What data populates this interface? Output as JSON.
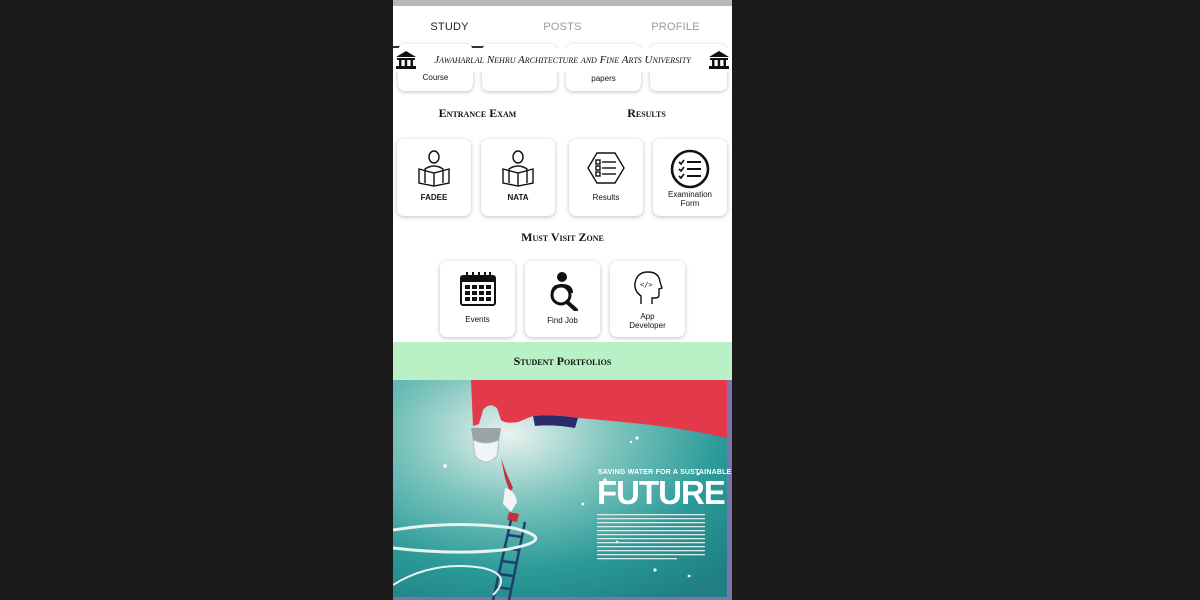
{
  "tabs": [
    {
      "label": "STUDY",
      "active": true
    },
    {
      "label": "POSTS",
      "active": false
    },
    {
      "label": "PROFILE",
      "active": false
    }
  ],
  "header": {
    "university": "Jawaharlal Nehru Architecture and Fine Arts University",
    "icon": "university-building-icon"
  },
  "partial_row": [
    {
      "label": "Course"
    },
    {
      "label": ""
    },
    {
      "label": "papers"
    },
    {
      "label": ""
    }
  ],
  "sections": {
    "entrance_exam": "Entrance Exam",
    "results": "Results",
    "must_visit": "Must Visit Zone"
  },
  "entrance_cards": [
    {
      "label": "FADEE",
      "icon": "reading-person-icon"
    },
    {
      "label": "NATA",
      "icon": "reading-person-icon"
    }
  ],
  "results_cards": [
    {
      "label": "Results",
      "icon": "result-list-icon"
    },
    {
      "label": "Examination Form",
      "icon": "checklist-icon"
    }
  ],
  "visit_cards": [
    {
      "label": "Events",
      "icon": "calendar-icon"
    },
    {
      "label": "Find Job",
      "icon": "job-search-icon"
    },
    {
      "label": "App Developer",
      "icon": "developer-head-icon"
    }
  ],
  "portfolio": {
    "title": "Student Portfolios",
    "poster_heading": "SAVING WATER FOR A SUSTAINABLE",
    "poster_title": "FUTURE"
  },
  "colors": {
    "banner": "#b9f0c6",
    "poster_teal": "#2a9a98",
    "pipe_red": "#e23a4a"
  }
}
